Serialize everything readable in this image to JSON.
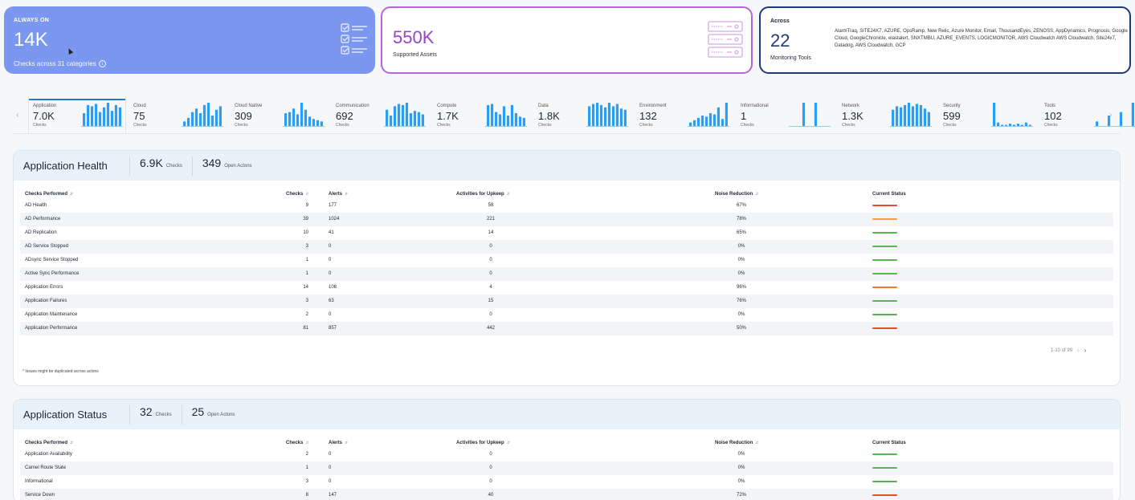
{
  "kpis": {
    "always_on": {
      "eyebrow": "ALWAYS ON",
      "value": "14K",
      "subtitle": "Checks across 31 categories",
      "icon": "checklist-icon"
    },
    "assets": {
      "value": "550K",
      "subtitle": "Supported Assets",
      "icon": "server-icon"
    },
    "tools": {
      "eyebrow": "Across",
      "value": "22",
      "subtitle": "Monitoring Tools",
      "list": "AlarmTraq, SITE24X7, AZURE, OpsRamp, New Relic, Azure Monitor, Email, ThousandEyes, ZENOSS, AppDynamics, Prognosis, Google Cloud, GoogleChronicle, elastalert, SNXTMBU, AZURE_EVENTS, LOGICMONITOR, AWS Cloudwatch AWS Cloudwatch, Site24x7, Datadog, AWS Cloudwatch, GCP"
    }
  },
  "categories": [
    {
      "name": "Application",
      "value": "7.0K",
      "unit": "Checks",
      "active": true,
      "bars": [
        0.55,
        0.9,
        0.85,
        0.95,
        0.6,
        0.8,
        1,
        0.65,
        0.9,
        0.8
      ]
    },
    {
      "name": "Cloud",
      "value": "75",
      "unit": "Checks",
      "bars": [
        0.2,
        0.35,
        0.6,
        0.75,
        0.55,
        0.9,
        1,
        0.45,
        0.7,
        0.85
      ]
    },
    {
      "name": "Cloud Native",
      "value": "309",
      "unit": "Checks",
      "bars": [
        0.55,
        0.6,
        0.75,
        0.5,
        1,
        0.7,
        0.4,
        0.3,
        0.25,
        0.2
      ]
    },
    {
      "name": "Communication",
      "value": "692",
      "unit": "Checks",
      "bars": [
        0.7,
        0.45,
        0.85,
        0.95,
        0.9,
        1,
        0.55,
        0.65,
        0.6,
        0.5
      ]
    },
    {
      "name": "Compute",
      "value": "1.7K",
      "unit": "Checks",
      "bars": [
        0.9,
        0.95,
        0.6,
        0.5,
        0.85,
        0.45,
        0.9,
        0.55,
        0.4,
        0.35
      ]
    },
    {
      "name": "Data",
      "value": "1.8K",
      "unit": "Checks",
      "bars": [
        0.85,
        0.95,
        1,
        0.9,
        0.8,
        1,
        0.85,
        0.95,
        0.75,
        0.7
      ]
    },
    {
      "name": "Environment",
      "value": "132",
      "unit": "Checks",
      "bars": [
        0.15,
        0.25,
        0.35,
        0.45,
        0.4,
        0.55,
        0.5,
        0.8,
        0.3,
        1
      ]
    },
    {
      "name": "Informational",
      "value": "1",
      "unit": "Checks",
      "bars": [
        0,
        0,
        0,
        1,
        0,
        0,
        1,
        0,
        0,
        0
      ]
    },
    {
      "name": "Network",
      "value": "1.3K",
      "unit": "Checks",
      "bars": [
        0.7,
        0.85,
        0.8,
        0.9,
        1,
        0.85,
        0.95,
        0.9,
        0.75,
        0.6
      ]
    },
    {
      "name": "Security",
      "value": "599",
      "unit": "Checks",
      "bars": [
        1,
        0.15,
        0.05,
        0.05,
        0.1,
        0.05,
        0.1,
        0.05,
        0.15,
        0.05
      ]
    },
    {
      "name": "Tools",
      "value": "102",
      "unit": "Checks",
      "bars": [
        0.2,
        0.45,
        0.6,
        1
      ]
    }
  ],
  "columns": {
    "name": "Checks Performed",
    "checks": "Checks",
    "alerts": "Alerts",
    "activities": "Activities for Upkeep",
    "noise": "Noise Reduction",
    "status": "Current Status"
  },
  "app_health": {
    "title": "Application Health",
    "checks_value": "6.9K",
    "checks_label": "Checks",
    "actions_value": "349",
    "actions_label": "Open Actons",
    "rows": [
      {
        "name": "AD Health",
        "checks": "9",
        "alerts": "177",
        "activities": "58",
        "noise": "67%",
        "status": "red"
      },
      {
        "name": "AD Performance",
        "checks": "39",
        "alerts": "1024",
        "activities": "221",
        "noise": "78%",
        "status": "orange"
      },
      {
        "name": "AD Replication",
        "checks": "10",
        "alerts": "41",
        "activities": "14",
        "noise": "65%",
        "status": "green"
      },
      {
        "name": "AD Service Stopped",
        "checks": "3",
        "alerts": "0",
        "activities": "0",
        "noise": "0%",
        "status": "green"
      },
      {
        "name": "ADsync Service Stopped",
        "checks": "1",
        "alerts": "0",
        "activities": "0",
        "noise": "0%",
        "status": "green"
      },
      {
        "name": "Active Sync Performance",
        "checks": "1",
        "alerts": "0",
        "activities": "0",
        "noise": "0%",
        "status": "green"
      },
      {
        "name": "Application Errors",
        "checks": "14",
        "alerts": "108",
        "activities": "4",
        "noise": "96%",
        "status": "darkorange"
      },
      {
        "name": "Application Failures",
        "checks": "3",
        "alerts": "63",
        "activities": "15",
        "noise": "76%",
        "status": "green"
      },
      {
        "name": "Application Maintenance",
        "checks": "2",
        "alerts": "0",
        "activities": "0",
        "noise": "0%",
        "status": "green"
      },
      {
        "name": "Application Performance",
        "checks": "81",
        "alerts": "857",
        "activities": "442",
        "noise": "50%",
        "status": "red"
      }
    ],
    "pager": "1-10 of 99",
    "footnote": "* Issues might be duplicated across actons"
  },
  "app_status": {
    "title": "Application Status",
    "checks_value": "32",
    "checks_label": "Checks",
    "actions_value": "25",
    "actions_label": "Open Actons",
    "rows": [
      {
        "name": "Application Availability",
        "checks": "2",
        "alerts": "0",
        "activities": "0",
        "noise": "0%",
        "status": "green"
      },
      {
        "name": "Carnel Route State",
        "checks": "1",
        "alerts": "0",
        "activities": "0",
        "noise": "0%",
        "status": "green"
      },
      {
        "name": "Informational",
        "checks": "3",
        "alerts": "0",
        "activities": "0",
        "noise": "0%",
        "status": "green"
      },
      {
        "name": "Service Down",
        "checks": "8",
        "alerts": "147",
        "activities": "40",
        "noise": "72%",
        "status": "red"
      }
    ]
  },
  "colors": {
    "bar": "#2a9df4",
    "green": "#59b550",
    "red": "#e44b2f",
    "orange": "#f1a23a",
    "darkorange": "#ee7a2f"
  }
}
